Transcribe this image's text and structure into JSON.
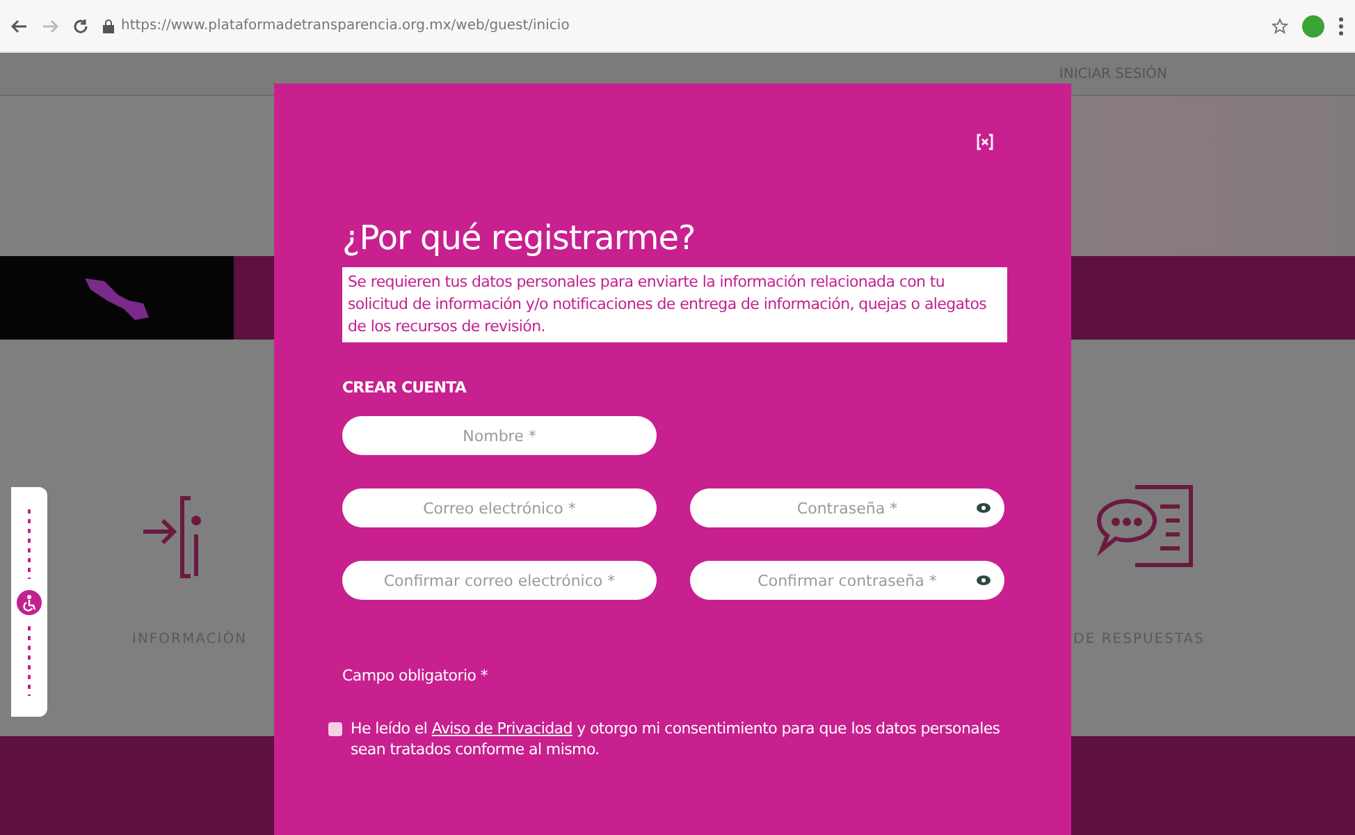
{
  "browser": {
    "url": "https://www.plataformadetransparencia.org.mx/web/guest/inicio"
  },
  "page": {
    "login_link": "INICIAR SESIÓN",
    "section_left": "INFORMACIÓN",
    "section_right": "DE RESPUESTAS"
  },
  "modal": {
    "title": "¿Por qué registrarme?",
    "description": "Se requieren tus datos personales para enviarte la información relacionada con tu solicitud de información y/o notificaciones de entrega de información, quejas o alegatos de los recursos de revisión.",
    "section_heading": "CREAR CUENTA",
    "field_rows": [
      [
        {
          "placeholder": "Nombre *",
          "reveal": false
        }
      ],
      [
        {
          "placeholder": "Correo electrónico *",
          "reveal": false
        },
        {
          "placeholder": "Contraseña *",
          "reveal": true
        }
      ],
      [
        {
          "placeholder": "Confirmar correo electrónico *",
          "reveal": false
        },
        {
          "placeholder": "Confirmar contraseña *",
          "reveal": true
        }
      ]
    ],
    "required_note": "Campo obligatorio *",
    "consent": {
      "checked": false,
      "before": "He leído el",
      "link": "Aviso de Privacidad",
      "after": "y otorgo mi consentimiento para que los datos personales sean tratados conforme al mismo."
    }
  }
}
